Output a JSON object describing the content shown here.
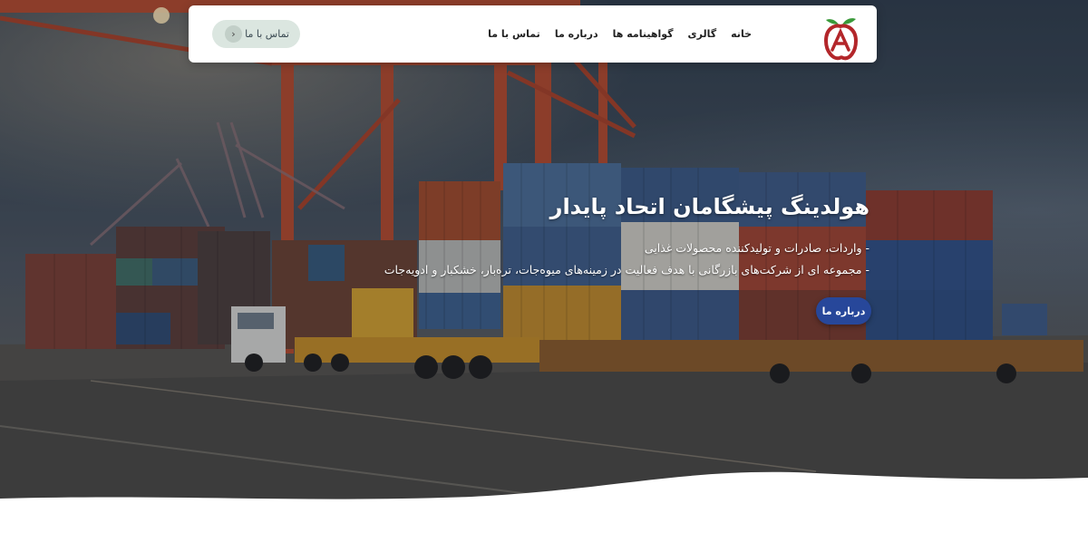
{
  "nav": {
    "items": [
      {
        "label": "خانه"
      },
      {
        "label": "گالری"
      },
      {
        "label": "گواهینامه ها"
      },
      {
        "label": "درباره ما"
      },
      {
        "label": "تماس با ما"
      }
    ],
    "contact_button": {
      "label": "تماس با ما",
      "icon": "chevron-left-icon"
    },
    "logo": {
      "icon": "apple-logo",
      "colors": {
        "fruit": "#b3262a",
        "leaf": "#3a9a3a"
      }
    }
  },
  "hero": {
    "title": "هولدینگ پیشگامان اتحاد پایدار",
    "lines": [
      "- واردات، صادرات و تولیدکننده محصولات غذایی",
      "- مجموعه ای از شرکت‌های بازرگانی با هدف فعالیت در زمینه‌های میوه‌جات، تره‌بار، خشکبار و ادویه‌جات"
    ],
    "button_label": "درباره ما",
    "button_color": "#27479a",
    "background": "container-port-photo"
  }
}
